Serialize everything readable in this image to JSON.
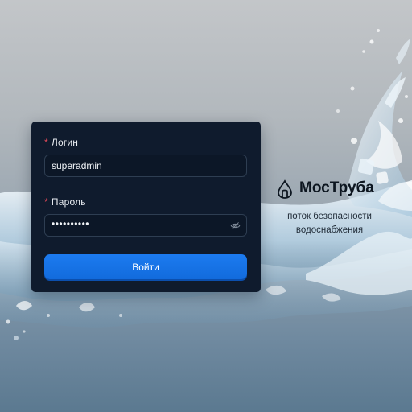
{
  "login_form": {
    "login_label": "Логин",
    "login_value": "superadmin",
    "password_label": "Пароль",
    "password_value": "••••••••••",
    "required_mark": "*",
    "submit_label": "Войти"
  },
  "brand": {
    "name": "МосТруба",
    "tagline_line1": "поток безопасности",
    "tagline_line2": "водоснабжения"
  },
  "colors": {
    "card_background": "#0f1b2d",
    "accent": "#1672e6",
    "required": "#e24a5a",
    "brand_text": "#0d1620"
  },
  "icons": {
    "password_toggle": "eye-off-icon",
    "brand_logo": "drop-pipe-logo"
  }
}
